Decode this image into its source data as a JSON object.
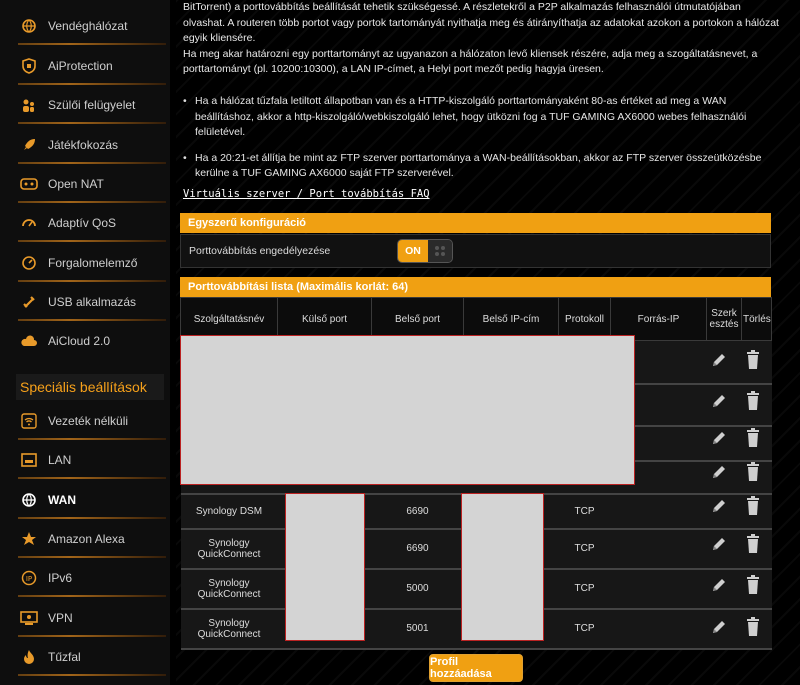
{
  "sidebar": {
    "items": [
      {
        "label": "Vendéghálózat",
        "icon": "globe-icon"
      },
      {
        "label": "AiProtection",
        "icon": "shield-icon"
      },
      {
        "label": "Szülői felügyelet",
        "icon": "parental-icon"
      },
      {
        "label": "Játékfokozás",
        "icon": "rocket-icon"
      },
      {
        "label": "Open NAT",
        "icon": "open-nat-icon"
      },
      {
        "label": "Adaptív QoS",
        "icon": "qos-icon"
      },
      {
        "label": "Forgalomelemző",
        "icon": "traffic-icon"
      },
      {
        "label": "USB alkalmazás",
        "icon": "usb-icon"
      },
      {
        "label": "AiCloud 2.0",
        "icon": "cloud-icon"
      }
    ],
    "section_title": "Speciális beállítások",
    "advanced_items": [
      {
        "label": "Vezeték nélküli",
        "icon": "wifi-icon"
      },
      {
        "label": "LAN",
        "icon": "lan-icon"
      },
      {
        "label": "WAN",
        "icon": "wan-globe-icon"
      },
      {
        "label": "Amazon Alexa",
        "icon": "alexa-icon"
      },
      {
        "label": "IPv6",
        "icon": "ipv6-icon"
      },
      {
        "label": "VPN",
        "icon": "vpn-icon"
      },
      {
        "label": "Tűzfal",
        "icon": "firewall-icon"
      }
    ]
  },
  "intro": {
    "line1": "BitTorrent) a porttovábbítás beállítását tehetik szükségessé. A részletekről a P2P alkalmazás felhasználói útmutatójában",
    "line2": "olvashat. A routeren több portot vagy portok tartományát nyithatja meg és átirányíthatja az adatokat azokon a portokon a hálózat",
    "line3": "egyik kliensére.",
    "line4": "Ha meg akar határozni egy porttartományt az ugyanazon a hálózaton levő kliensek részére, adja meg a szogáltatásnevet, a",
    "line5": "porttartományt (pl. 10200:10300), a LAN IP-címet, a Helyi port mezőt pedig hagyja üresen."
  },
  "bullets": [
    {
      "l1": "Ha a hálózat tűzfala letiltott állapotban van és a HTTP-kiszolgáló porttartományaként 80-as értéket ad meg a WAN",
      "l2": "beállításhoz, akkor a http-kiszolgáló/webkiszolgáló lehet, hogy ütközni fog a TUF GAMING AX6000 webes felhasználói",
      "l3": "felületével."
    },
    {
      "l1": "Ha a 20:21-et állítja be mint az FTP szerver porttartománya a WAN-beállításokban, akkor az FTP szerver összeütközésbe",
      "l2": "kerülne a TUF GAMING AX6000 saját FTP szerverével."
    }
  ],
  "faq_link": "Virtuális szerver / Port továbbítás FAQ",
  "simple_config": {
    "title": "Egyszerű konfiguráció",
    "label": "Porttovábbítás engedélyezése",
    "toggle_state": "ON"
  },
  "list": {
    "title": "Porttovábbítási lista (Maximális korlát: 64)",
    "headers": [
      "Szolgáltatásnév",
      "Külső port",
      "Belső port",
      "Belső IP-cím",
      "Protokoll",
      "Forrás-IP",
      "Szerk esztés",
      "Törlés"
    ],
    "rows": [
      {
        "service": "Synology DSM",
        "internal_port": "6690",
        "protocol": "TCP"
      },
      {
        "service": "Synology QuickConnect",
        "internal_port": "6690",
        "protocol": "TCP"
      },
      {
        "service": "Synology QuickConnect",
        "internal_port": "5000",
        "protocol": "TCP"
      },
      {
        "service": "Synology QuickConnect",
        "internal_port": "5001",
        "protocol": "TCP"
      }
    ]
  },
  "add_button": "Profil hozzáadása",
  "colors": {
    "accent": "#f0a012",
    "background": "#000000",
    "panel": "#171717"
  }
}
